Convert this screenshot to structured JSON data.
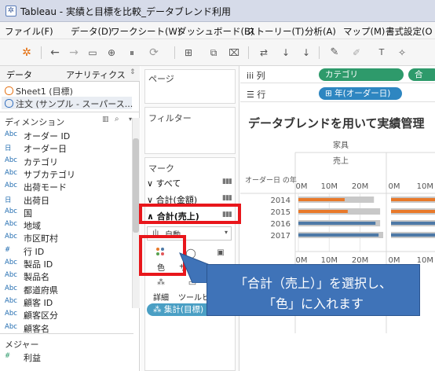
{
  "window": {
    "title": "Tableau - 実績と目標を比較_データブレンド利用"
  },
  "menu": [
    "ファイル(F)",
    "データ(D)",
    "ワークシート(W)",
    "ダッシュボード(B)",
    "ストーリー(T)",
    "分析(A)",
    "マップ(M)",
    "書式設定(O"
  ],
  "toolbar": {
    "icons": [
      "tableau-logo-icon",
      "back-icon",
      "forward-icon",
      "save-icon",
      "new-datasource-icon",
      "pause-icon",
      "refresh-icon",
      "new-sheet-icon",
      "duplicate-icon",
      "clear-icon",
      "swap-icon",
      "sort-asc-icon",
      "sort-desc-icon",
      "highlight-icon",
      "pin-icon",
      "label-icon",
      "fix-icon"
    ]
  },
  "data_pane": {
    "tabs": [
      "データ",
      "アナリティクス"
    ],
    "sources": [
      "Sheet1 (目標)",
      "注文 (サンプル - スーパース..."
    ],
    "dimensions_header": "ディメンション",
    "dimensions": [
      {
        "type": "Abc",
        "name": "オーダー ID"
      },
      {
        "type": "日",
        "name": "オーダー日"
      },
      {
        "type": "Abc",
        "name": "カテゴリ"
      },
      {
        "type": "Abc",
        "name": "サブカテゴリ"
      },
      {
        "type": "Abc",
        "name": "出荷モード"
      },
      {
        "type": "日",
        "name": "出荷日"
      },
      {
        "type": "Abc",
        "name": "国"
      },
      {
        "type": "Abc",
        "name": "地域"
      },
      {
        "type": "Abc",
        "name": "市区町村"
      },
      {
        "type": "#",
        "name": "行 ID"
      },
      {
        "type": "Abc",
        "name": "製品 ID"
      },
      {
        "type": "Abc",
        "name": "製品名"
      },
      {
        "type": "Abc",
        "name": "都道府県"
      },
      {
        "type": "Abc",
        "name": "顧客 ID"
      },
      {
        "type": "Abc",
        "name": "顧客区分"
      },
      {
        "type": "Abc",
        "name": "顧客名"
      }
    ],
    "measures_header": "メジャー",
    "measures": [
      {
        "type": "#",
        "name": "利益"
      }
    ]
  },
  "shelves": {
    "pages_label": "ページ",
    "filters_label": "フィルター",
    "marks_label": "マーク",
    "marks_all": "すべて",
    "marks_sum_amount": "合計(金額)",
    "marks_sum_sales": "合計(売上)",
    "mark_type": "自動",
    "mark_buttons": {
      "color": "色",
      "size": "サイズ",
      "label": "ラベル",
      "detail": "詳細",
      "tooltip": "ツールヒント"
    },
    "mark_pill": "集計(目標)"
  },
  "view": {
    "columns_label": "列",
    "rows_label": "行",
    "columns_pills": [
      "カテゴリ",
      "合"
    ],
    "rows_pill": "年(オーダー日)",
    "sheet_title": "データブレンドを用いて実績管理"
  },
  "chart_data": {
    "type": "bar",
    "header_category": "家具",
    "header_measure": "売上",
    "row_header": "オーダー日 の年",
    "categories": [
      "2014",
      "2015",
      "2016",
      "2017"
    ],
    "x_ticks": [
      "0M",
      "10M",
      "20M"
    ],
    "series": [
      {
        "name": "",
        "color": "#e8792a",
        "values": [
          15,
          16,
          20,
          24
        ]
      },
      {
        "name": "",
        "color": "#4e79a7",
        "values": [
          23,
          25,
          25,
          26
        ]
      }
    ],
    "xlim": [
      0,
      28
    ]
  },
  "annotation": {
    "line1": "「合計（売上）」を選択し、",
    "line2": "「色」に入れます",
    "accent_color": "#e8161b",
    "callout_color": "#3f73b8"
  }
}
